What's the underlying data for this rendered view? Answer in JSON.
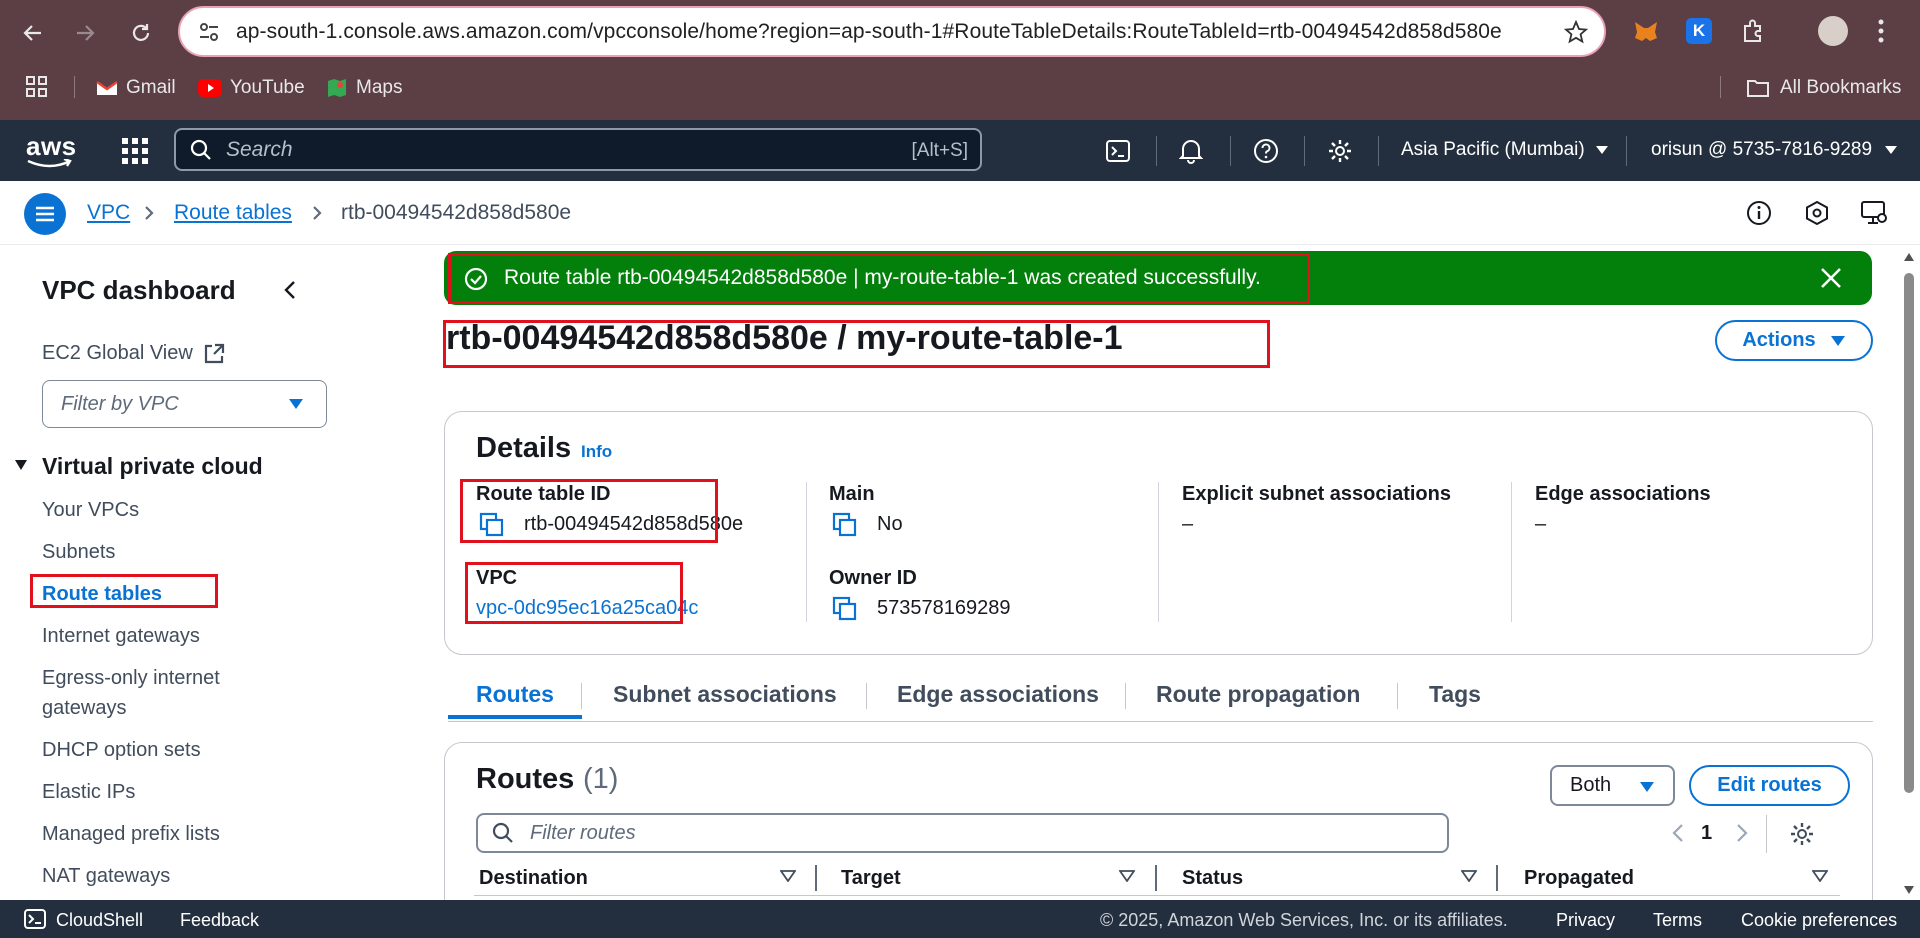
{
  "browser": {
    "url": "ap-south-1.console.aws.amazon.com/vpcconsole/home?region=ap-south-1#RouteTableDetails:RouteTableId=rtb-00494542d858d580e",
    "bookmarks": [
      "Gmail",
      "YouTube",
      "Maps"
    ],
    "all_bookmarks": "All Bookmarks"
  },
  "awsnav": {
    "logo": "aws",
    "search_placeholder": "Search",
    "search_shortcut": "[Alt+S]",
    "region": "Asia Pacific (Mumbai)",
    "account": "orisun @ 5735-7816-9289"
  },
  "breadcrumb": [
    "VPC",
    "Route tables",
    "rtb-00494542d858d580e"
  ],
  "sidebar": {
    "title": "VPC dashboard",
    "ec2_global_view": "EC2 Global View",
    "filter_placeholder": "Filter by VPC",
    "section": "Virtual private cloud",
    "items": [
      "Your VPCs",
      "Subnets",
      "Route tables",
      "Internet gateways",
      "Egress-only internet",
      "gateways",
      "DHCP option sets",
      "Elastic IPs",
      "Managed prefix lists",
      "NAT gateways"
    ]
  },
  "flash": {
    "message": "Route table rtb-00494542d858d580e | my-route-table-1 was created successfully."
  },
  "page": {
    "title": "rtb-00494542d858d580e / my-route-table-1",
    "actions": "Actions"
  },
  "details": {
    "heading": "Details",
    "info": "Info",
    "route_table_id_label": "Route table ID",
    "route_table_id": "rtb-00494542d858d580e",
    "main_label": "Main",
    "main": "No",
    "explicit_label": "Explicit subnet associations",
    "explicit": "–",
    "edge_label": "Edge associations",
    "edge": "–",
    "vpc_label": "VPC",
    "vpc": "vpc-0dc95ec16a25ca04c",
    "owner_label": "Owner ID",
    "owner": "573578169289"
  },
  "tabs": [
    "Routes",
    "Subnet associations",
    "Edge associations",
    "Route propagation",
    "Tags"
  ],
  "routes": {
    "heading": "Routes",
    "count": "(1)",
    "both": "Both",
    "edit": "Edit routes",
    "filter_placeholder": "Filter routes",
    "page": "1",
    "columns": [
      "Destination",
      "Target",
      "Status",
      "Propagated"
    ]
  },
  "footer": {
    "cloudshell": "CloudShell",
    "feedback": "Feedback",
    "copyright": "© 2025, Amazon Web Services, Inc. or its affiliates.",
    "privacy": "Privacy",
    "terms": "Terms",
    "cookies": "Cookie preferences"
  },
  "colors": {
    "chrome": "#5c3e45",
    "aws_nav": "#232f3e",
    "link": "#0972d3",
    "success": "#037f0c",
    "highlight": "#e0111d"
  }
}
